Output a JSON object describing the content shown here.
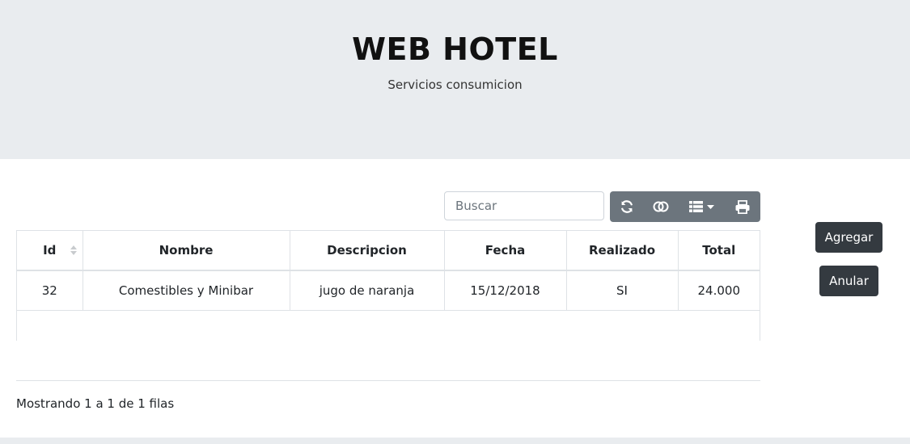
{
  "header": {
    "title": "WEB HOTEL",
    "subtitle": "Servicios consumicion"
  },
  "search": {
    "placeholder": "Buscar",
    "value": ""
  },
  "toolbar": {
    "buttons": [
      {
        "icon": "refresh-icon"
      },
      {
        "icon": "toggle-icon"
      },
      {
        "icon": "columns-icon",
        "has_dropdown": true
      },
      {
        "icon": "print-icon"
      }
    ]
  },
  "table": {
    "columns": [
      "Id",
      "Nombre",
      "Descripcion",
      "Fecha",
      "Realizado",
      "Total"
    ],
    "rows": [
      [
        "32",
        "Comestibles y Minibar",
        "jugo de naranja",
        "15/12/2018",
        "SI",
        "24.000"
      ]
    ]
  },
  "pagination": {
    "info": "Mostrando 1 a 1 de 1 filas"
  },
  "actions": {
    "add_label": "Agregar",
    "cancel_label": "Anular"
  },
  "colors": {
    "header_bg": "#e9ecef",
    "toolbar_bg": "#6c757d",
    "dark_button": "#343a40"
  }
}
